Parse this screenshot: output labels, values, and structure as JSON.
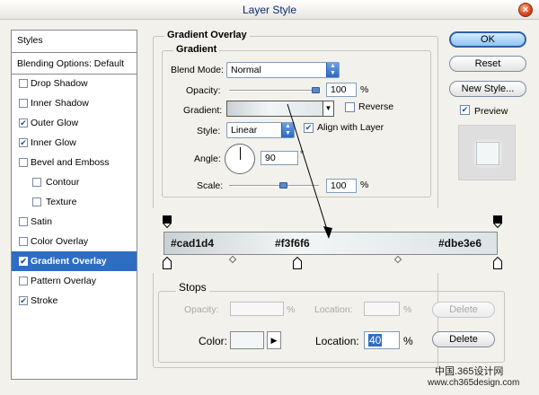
{
  "window": {
    "title": "Layer Style",
    "close": "×"
  },
  "styles_panel": {
    "header": "Styles",
    "blending": "Blending Options: Default",
    "items": [
      {
        "label": "Drop Shadow",
        "checked": false
      },
      {
        "label": "Inner Shadow",
        "checked": false
      },
      {
        "label": "Outer Glow",
        "checked": true
      },
      {
        "label": "Inner Glow",
        "checked": true
      },
      {
        "label": "Bevel and Emboss",
        "checked": false
      },
      {
        "label": "Contour",
        "checked": false
      },
      {
        "label": "Texture",
        "checked": false
      },
      {
        "label": "Satin",
        "checked": false
      },
      {
        "label": "Color Overlay",
        "checked": false
      },
      {
        "label": "Gradient Overlay",
        "checked": true
      },
      {
        "label": "Pattern Overlay",
        "checked": false
      },
      {
        "label": "Stroke",
        "checked": true
      }
    ]
  },
  "gradient_overlay": {
    "group_title": "Gradient Overlay",
    "sub_title": "Gradient",
    "blend_mode_label": "Blend Mode:",
    "blend_mode_value": "Normal",
    "opacity_label": "Opacity:",
    "opacity_value": "100",
    "opacity_unit": "%",
    "opacity_level": 100,
    "gradient_label": "Gradient:",
    "reverse_label": "Reverse",
    "reverse_checked": false,
    "style_label": "Style:",
    "style_value": "Linear",
    "align_label": "Align with Layer",
    "align_checked": true,
    "angle_label": "Angle:",
    "angle_value": "90",
    "angle_unit": "°",
    "scale_label": "Scale:",
    "scale_value": "100",
    "scale_unit": "%",
    "scale_level": 100
  },
  "gradient_editor": {
    "stop_labels": [
      "#cad1d4",
      "#f3f6f6",
      "#dbe3e6"
    ],
    "colors": [
      "#cad1d4",
      "#f3f6f6",
      "#dbe3e6"
    ]
  },
  "stops": {
    "group_title": "Stops",
    "opacity_label": "Opacity:",
    "opacity_unit": "%",
    "location_label_1": "Location:",
    "location_unit_1": "%",
    "delete_label_1": "Delete",
    "color_label": "Color:",
    "location_label_2": "Location:",
    "location_value": "40",
    "location_unit_2": "%",
    "delete_label_2": "Delete"
  },
  "buttons": {
    "ok": "OK",
    "reset": "Reset",
    "new_style": "New Style...",
    "preview_label": "Preview",
    "preview_checked": true
  },
  "watermark": {
    "line1": "中国.365设计网",
    "line2": "www.ch365design.com"
  }
}
